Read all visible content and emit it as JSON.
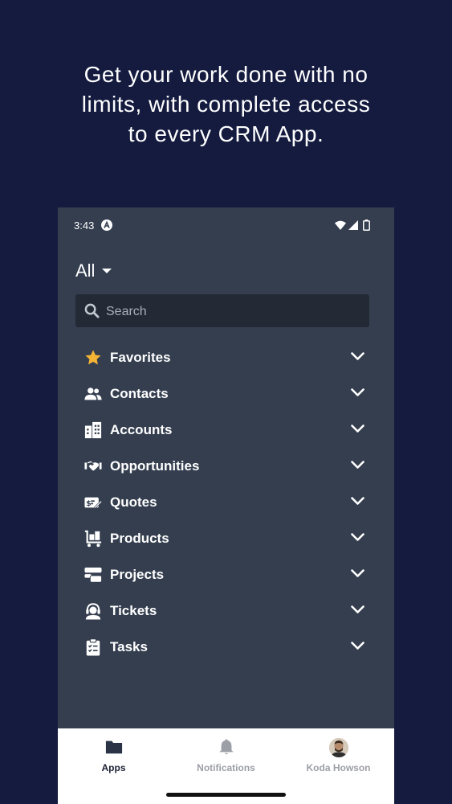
{
  "promo": {
    "lines": [
      "Get your work done with no",
      "limits, with complete access",
      "to every CRM App."
    ]
  },
  "status_bar": {
    "time": "3:43"
  },
  "filter": {
    "label": "All"
  },
  "search": {
    "placeholder": "Search",
    "value": ""
  },
  "apps": [
    {
      "label": "Favorites",
      "icon": "star-icon",
      "color": "#f5b335"
    },
    {
      "label": "Contacts",
      "icon": "contacts-icon"
    },
    {
      "label": "Accounts",
      "icon": "building-icon"
    },
    {
      "label": "Opportunities",
      "icon": "handshake-icon"
    },
    {
      "label": "Quotes",
      "icon": "quote-icon"
    },
    {
      "label": "Products",
      "icon": "products-cart-icon"
    },
    {
      "label": "Projects",
      "icon": "projects-icon"
    },
    {
      "label": "Tickets",
      "icon": "support-agent-icon"
    },
    {
      "label": "Tasks",
      "icon": "clipboard-icon"
    }
  ],
  "tabs": [
    {
      "label": "Apps",
      "icon": "folder-icon",
      "active": true
    },
    {
      "label": "Notifications",
      "icon": "bell-icon",
      "active": false
    },
    {
      "label": "Koda Howson",
      "icon": "avatar",
      "active": false
    }
  ],
  "colors": {
    "background": "#141b3f",
    "panel": "#343e4f",
    "search_bg": "#232a36",
    "tabbar": "#ffffff"
  }
}
